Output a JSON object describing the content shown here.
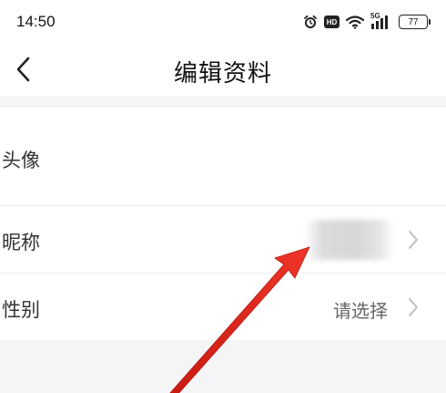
{
  "status_bar": {
    "time": "14:50",
    "icons": [
      "alarm-icon",
      "hd-icon",
      "wifi-icon",
      "5g-signal-icon"
    ],
    "network_label": "5G",
    "hd_label": "HD",
    "battery_level": "77"
  },
  "nav": {
    "title": "编辑资料",
    "back_icon": "chevron-left-icon"
  },
  "settings": {
    "rows": [
      {
        "label": "头像"
      },
      {
        "label": "昵称",
        "value_obscured": true
      },
      {
        "label": "性别",
        "value": "请选择"
      }
    ]
  },
  "annotation": {
    "color": "#e8281e",
    "icon": "red-arrow"
  },
  "colors": {
    "page_background": "#f5f5f7",
    "card_background": "#ffffff",
    "divider": "#eeeeee",
    "chevron": "#bbbbbb"
  }
}
